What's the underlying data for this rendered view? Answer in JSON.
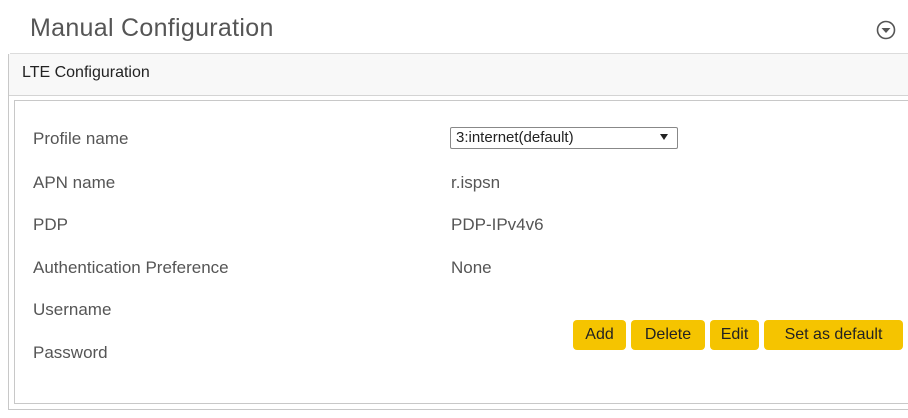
{
  "section_title": "Manual Configuration",
  "panel": {
    "title": "LTE Configuration"
  },
  "fields": {
    "profile_name": {
      "label": "Profile name",
      "selected": "3:internet(default)"
    },
    "apn_name": {
      "label": "APN name",
      "value": "r.ispsn"
    },
    "pdp": {
      "label": "PDP",
      "value": "PDP-IPv4v6"
    },
    "auth_pref": {
      "label": "Authentication Preference",
      "value": "None"
    },
    "username": {
      "label": "Username",
      "value": ""
    },
    "password": {
      "label": "Password",
      "value": ""
    }
  },
  "actions": {
    "add": "Add",
    "delete": "Delete",
    "edit": "Edit",
    "set_default": "Set as default"
  },
  "colors": {
    "button_bg": "#f5c400",
    "panel_header_bg": "#f8f8f8"
  },
  "icons": {
    "collapse": "chevron-down-circle-icon"
  }
}
